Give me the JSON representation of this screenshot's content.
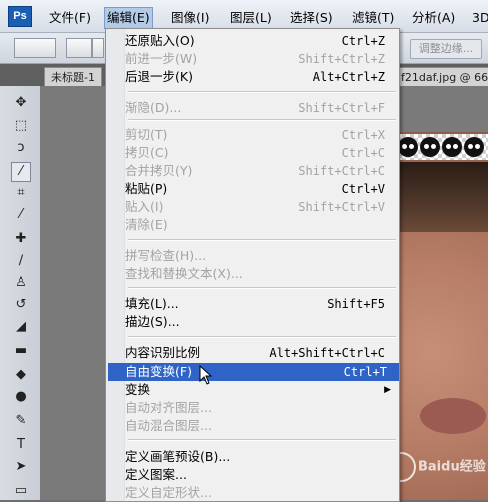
{
  "app": {
    "logo": "Ps"
  },
  "menubar": {
    "items": [
      {
        "label": "文件(F)"
      },
      {
        "label": "编辑(E)"
      },
      {
        "label": "图像(I)"
      },
      {
        "label": "图层(L)"
      },
      {
        "label": "选择(S)"
      },
      {
        "label": "滤镜(T)"
      },
      {
        "label": "分析(A)"
      },
      {
        "label": "3D"
      }
    ],
    "active_index": 1
  },
  "optionsbar": {
    "refine_edge_label": "调整边缘..."
  },
  "tabs": {
    "left_tab": "未标题-1",
    "right_tab": "f21daf.jpg @ 66"
  },
  "tools": [
    {
      "name": "move-tool-icon",
      "glyph": "✥"
    },
    {
      "name": "marquee-tool-icon",
      "glyph": "⬚"
    },
    {
      "name": "lasso-tool-icon",
      "glyph": "ↄ"
    },
    {
      "name": "magic-wand-tool-icon",
      "glyph": "⁄"
    },
    {
      "name": "crop-tool-icon",
      "glyph": "⌗"
    },
    {
      "name": "eyedropper-tool-icon",
      "glyph": "⁄"
    },
    {
      "name": "healing-brush-tool-icon",
      "glyph": "✚"
    },
    {
      "name": "brush-tool-icon",
      "glyph": "∕"
    },
    {
      "name": "stamp-tool-icon",
      "glyph": "♙"
    },
    {
      "name": "history-brush-tool-icon",
      "glyph": "↺"
    },
    {
      "name": "eraser-tool-icon",
      "glyph": "◢"
    },
    {
      "name": "gradient-tool-icon",
      "glyph": "▬"
    },
    {
      "name": "blur-tool-icon",
      "glyph": "◆"
    },
    {
      "name": "dodge-tool-icon",
      "glyph": "●"
    },
    {
      "name": "pen-tool-icon",
      "glyph": "✎"
    },
    {
      "name": "type-tool-icon",
      "glyph": "T"
    },
    {
      "name": "path-selection-tool-icon",
      "glyph": "➤"
    },
    {
      "name": "shape-tool-icon",
      "glyph": "▭"
    }
  ],
  "edit_menu": {
    "rows": [
      {
        "label": "还原贴入(O)",
        "shortcut": "Ctrl+Z",
        "disabled": false
      },
      {
        "label": "前进一步(W)",
        "shortcut": "Shift+Ctrl+Z",
        "disabled": true
      },
      {
        "label": "后退一步(K)",
        "shortcut": "Alt+Ctrl+Z",
        "disabled": false
      },
      {
        "label": "渐隐(D)...",
        "shortcut": "Shift+Ctrl+F",
        "disabled": true
      },
      {
        "label": "剪切(T)",
        "shortcut": "Ctrl+X",
        "disabled": true
      },
      {
        "label": "拷贝(C)",
        "shortcut": "Ctrl+C",
        "disabled": true
      },
      {
        "label": "合并拷贝(Y)",
        "shortcut": "Shift+Ctrl+C",
        "disabled": true
      },
      {
        "label": "粘贴(P)",
        "shortcut": "Ctrl+V",
        "disabled": false
      },
      {
        "label": "贴入(I)",
        "shortcut": "Shift+Ctrl+V",
        "disabled": true
      },
      {
        "label": "清除(E)",
        "shortcut": "",
        "disabled": true
      },
      {
        "label": "拼写检查(H)...",
        "shortcut": "",
        "disabled": true
      },
      {
        "label": "查找和替换文本(X)...",
        "shortcut": "",
        "disabled": true
      },
      {
        "label": "填充(L)...",
        "shortcut": "Shift+F5",
        "disabled": false
      },
      {
        "label": "描边(S)...",
        "shortcut": "",
        "disabled": false
      },
      {
        "label": "内容识别比例",
        "shortcut": "Alt+Shift+Ctrl+C",
        "disabled": false
      },
      {
        "label": "自由变换(F)",
        "shortcut": "Ctrl+T",
        "disabled": false,
        "highlight": true
      },
      {
        "label": "变换",
        "shortcut": "",
        "disabled": false,
        "submenu": true
      },
      {
        "label": "自动对齐图层...",
        "shortcut": "",
        "disabled": true
      },
      {
        "label": "自动混合图层...",
        "shortcut": "",
        "disabled": true
      },
      {
        "label": "定义画笔预设(B)...",
        "shortcut": "",
        "disabled": false
      },
      {
        "label": "定义图案...",
        "shortcut": "",
        "disabled": false
      },
      {
        "label": "定义自定形状...",
        "shortcut": "",
        "disabled": true
      }
    ]
  },
  "watermark": {
    "text": "Baidu经验"
  },
  "colors": {
    "highlight": "#2f64c6",
    "disabled_text": "#a3a3a3",
    "ps_logo": "#1a5fb4"
  }
}
